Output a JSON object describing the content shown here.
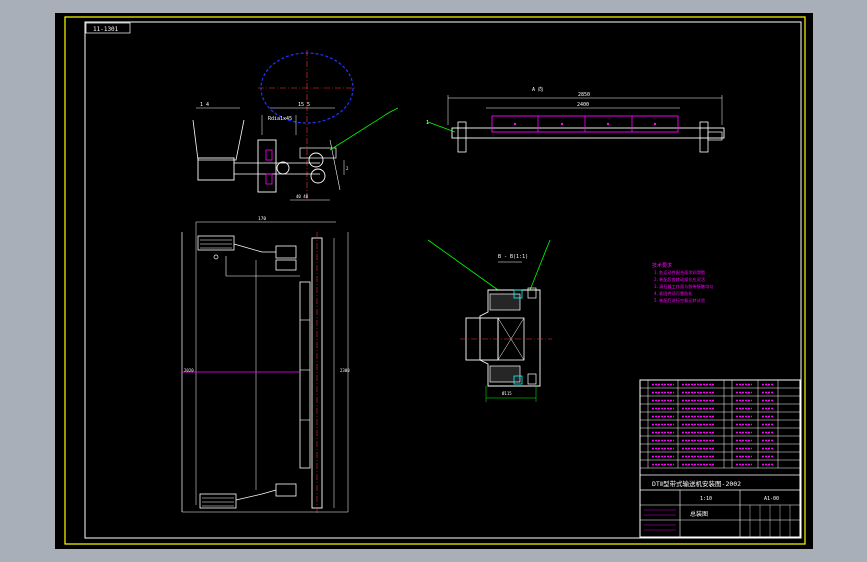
{
  "sheet": {
    "frame_tag": "11-1301",
    "top_view_label": "A 向",
    "top_dim_overall": "2850",
    "top_dim_inner": "2400",
    "section_label": "B - B(1:1)",
    "callouts": [
      "1",
      "2",
      "3",
      "4",
      "5",
      "6",
      "7",
      "8",
      "9",
      "10",
      "11",
      "12"
    ]
  },
  "tech_requirements": {
    "heading": "技术要求",
    "lines": [
      "1.各运动件配合面涂润滑脂",
      "2.装配后各转动部位应灵活",
      "3.清扫器工作面与胶带接触均匀",
      "4.紧固件须可靠防松",
      "5.装配后进行空载运转试验"
    ]
  },
  "title_block": {
    "title": "DTⅡ型带式输送机安装图-2002",
    "subtitle": "总装图",
    "scale": "1:10",
    "drawing_no": "A1-00"
  },
  "palette": {
    "background": "#000000",
    "frame": "#ffffff",
    "outer_border": "#ffff00",
    "callout": "#00ff00",
    "part": "#ff00ff",
    "centerline": "#ff0000",
    "hidden": "#0000ff",
    "note": "#ff00ff"
  }
}
